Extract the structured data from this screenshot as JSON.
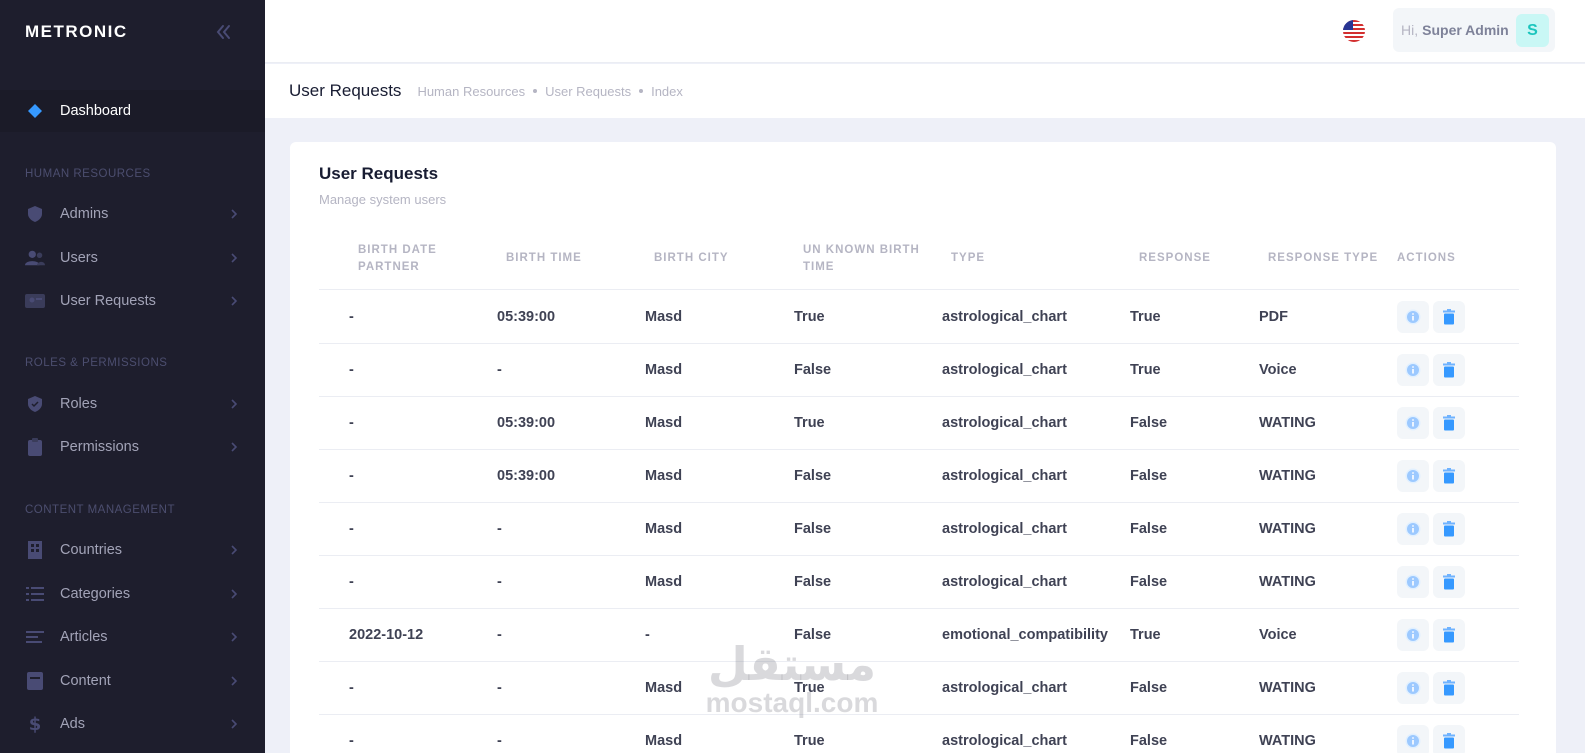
{
  "sidebar": {
    "logo": "METRONIC",
    "dashboard": "Dashboard",
    "sections": {
      "hr": "HUMAN RESOURCES",
      "roles": "ROLES & PERMISSIONS",
      "content": "CONTENT MANAGEMENT"
    },
    "items": {
      "admins": "Admins",
      "users": "Users",
      "user_requests": "User Requests",
      "roles": "Roles",
      "permissions": "Permissions",
      "countries": "Countries",
      "categories": "Categories",
      "articles": "Articles",
      "content": "Content",
      "ads": "Ads"
    }
  },
  "header": {
    "greeting": "Hi,",
    "user_name": "Super Admin",
    "avatar_letter": "S",
    "flag_icon": "us-flag-icon"
  },
  "subheader": {
    "title": "User Requests",
    "breadcrumb": [
      "Human Resources",
      "User Requests",
      "Index"
    ]
  },
  "card": {
    "title": "User Requests",
    "subtitle": "Manage system users"
  },
  "table": {
    "columns": {
      "birth_date_partner": "BIRTH DATE PARTNER",
      "birth_time": "BIRTH TIME",
      "birth_city": "BIRTH CITY",
      "unknown_birth_time": "UN KNOWN BIRTH TIME",
      "type": "TYPE",
      "response": "RESPONSE",
      "response_type": "RESPONSE TYPE",
      "actions": "ACTIONS"
    },
    "rows": [
      [
        "-",
        "05:39:00",
        "Masd",
        "True",
        "astrological_chart",
        "True",
        "PDF"
      ],
      [
        "-",
        "-",
        "Masd",
        "False",
        "astrological_chart",
        "True",
        "Voice"
      ],
      [
        "-",
        "05:39:00",
        "Masd",
        "True",
        "astrological_chart",
        "False",
        "WATING"
      ],
      [
        "-",
        "05:39:00",
        "Masd",
        "False",
        "astrological_chart",
        "False",
        "WATING"
      ],
      [
        "-",
        "-",
        "Masd",
        "False",
        "astrological_chart",
        "False",
        "WATING"
      ],
      [
        "-",
        "-",
        "Masd",
        "False",
        "astrological_chart",
        "False",
        "WATING"
      ],
      [
        "2022-10-12",
        "-",
        "-",
        "False",
        "emotional_compatibility",
        "True",
        "Voice"
      ],
      [
        "-",
        "-",
        "Masd",
        "True",
        "astrological_chart",
        "False",
        "WATING"
      ],
      [
        "-",
        "-",
        "Masd",
        "True",
        "astrological_chart",
        "False",
        "WATING"
      ]
    ]
  },
  "watermark": {
    "arabic": "مستقل",
    "latin": "mostaql.com"
  },
  "colors": {
    "sidebar_bg": "#1e1e2d",
    "accent": "#3699ff",
    "info_light": "#e1f0ff",
    "avatar_bg": "#c9f7f5"
  }
}
